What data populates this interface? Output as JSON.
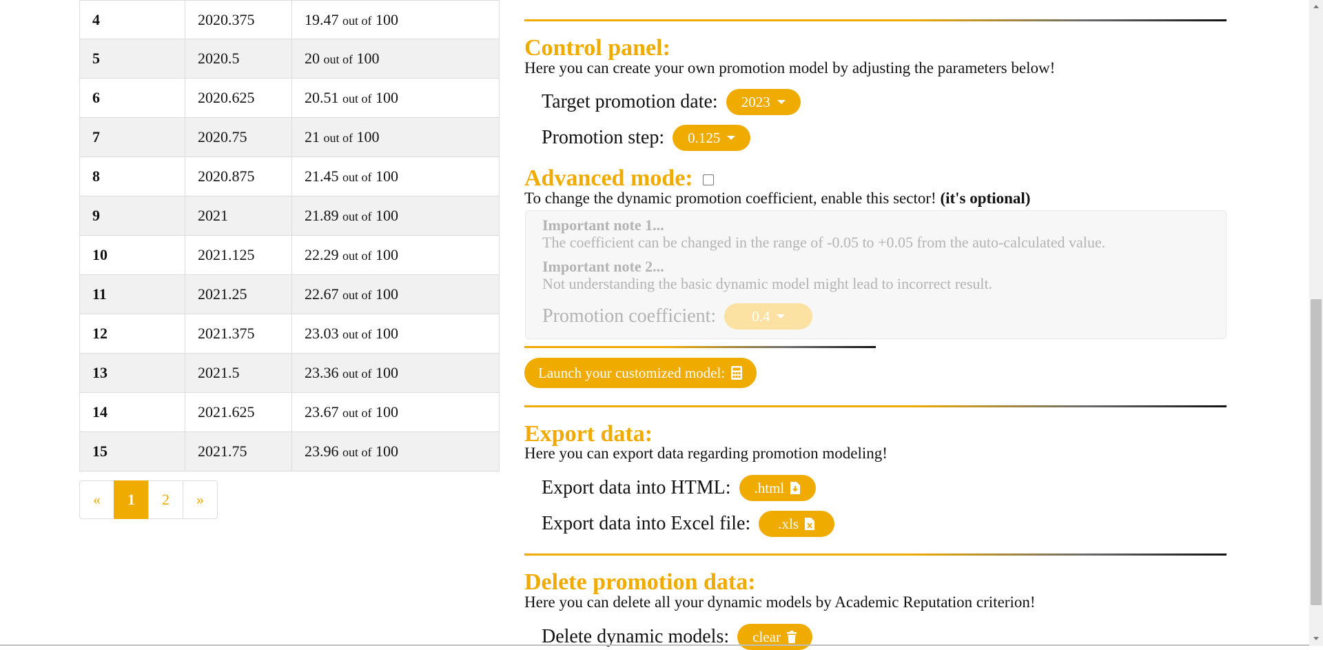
{
  "table": {
    "rows": [
      {
        "step": "4",
        "date": "2020.375",
        "score": "19.47",
        "suffix": "out of",
        "max": "100"
      },
      {
        "step": "5",
        "date": "2020.5",
        "score": "20",
        "suffix": "out of",
        "max": "100"
      },
      {
        "step": "6",
        "date": "2020.625",
        "score": "20.51",
        "suffix": "out of",
        "max": "100"
      },
      {
        "step": "7",
        "date": "2020.75",
        "score": "21",
        "suffix": "out of",
        "max": "100"
      },
      {
        "step": "8",
        "date": "2020.875",
        "score": "21.45",
        "suffix": "out of",
        "max": "100"
      },
      {
        "step": "9",
        "date": "2021",
        "score": "21.89",
        "suffix": "out of",
        "max": "100"
      },
      {
        "step": "10",
        "date": "2021.125",
        "score": "22.29",
        "suffix": "out of",
        "max": "100"
      },
      {
        "step": "11",
        "date": "2021.25",
        "score": "22.67",
        "suffix": "out of",
        "max": "100"
      },
      {
        "step": "12",
        "date": "2021.375",
        "score": "23.03",
        "suffix": "out of",
        "max": "100"
      },
      {
        "step": "13",
        "date": "2021.5",
        "score": "23.36",
        "suffix": "out of",
        "max": "100"
      },
      {
        "step": "14",
        "date": "2021.625",
        "score": "23.67",
        "suffix": "out of",
        "max": "100"
      },
      {
        "step": "15",
        "date": "2021.75",
        "score": "23.96",
        "suffix": "out of",
        "max": "100"
      }
    ]
  },
  "pagination": {
    "prev": "«",
    "pages": [
      "1",
      "2"
    ],
    "active": "1",
    "next": "»"
  },
  "control": {
    "title": "Control panel:",
    "desc": "Here you can create your own promotion model by adjusting the parameters below!",
    "target_label": "Target promotion date:",
    "target_value": "2023",
    "step_label": "Promotion step:",
    "step_value": "0.125"
  },
  "advanced": {
    "title": "Advanced mode:",
    "desc": "To change the dynamic promotion coefficient, enable this sector!",
    "optional": "(it's optional)",
    "note1_title": "Important note 1...",
    "note1_text": "The coefficient can be changed in the range of -0.05 to +0.05 from the auto-calculated value.",
    "note2_title": "Important note 2...",
    "note2_text": "Not understanding the basic dynamic model might lead to incorrect result.",
    "coef_label": "Promotion coefficient:",
    "coef_value": "0.4"
  },
  "launch_label": "Launch your customized model:",
  "export": {
    "title": "Export data:",
    "desc": "Here you can export data regarding promotion modeling!",
    "html_label": "Export data into HTML:",
    "html_btn": ".html",
    "xls_label": "Export data into Excel file:",
    "xls_btn": ".xls"
  },
  "delete": {
    "title": "Delete promotion data:",
    "desc": "Here you can delete all your dynamic models by Academic Reputation criterion!",
    "label": "Delete dynamic models:",
    "btn": "clear"
  },
  "colors": {
    "accent": "#f0ab00",
    "disabled_accent": "#fbe2a3"
  },
  "icons": [
    "caret-down-icon",
    "calculator-icon",
    "file-download-icon",
    "file-excel-icon",
    "trash-icon",
    "checkbox"
  ]
}
